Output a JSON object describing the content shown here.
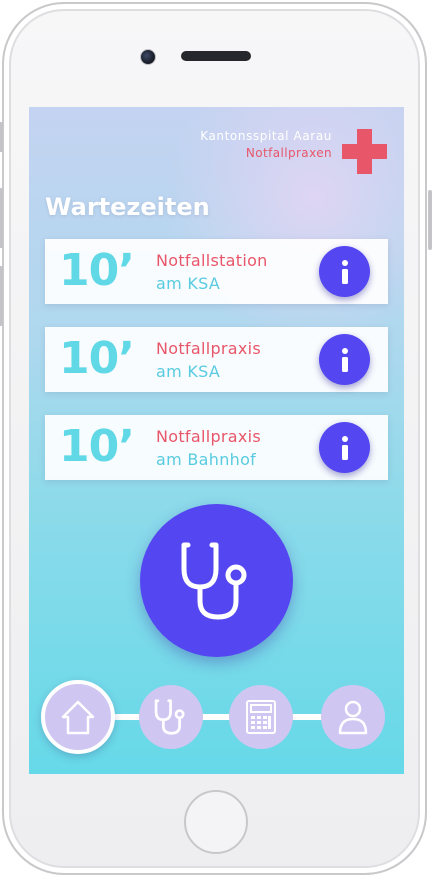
{
  "header": {
    "hospital_name": "Kantonsspital Aarau",
    "service_name": "Notfallpraxen",
    "logo_icon": "red-cross-icon"
  },
  "section_title": "Wartezeiten",
  "wait_cards": [
    {
      "wait": "10’",
      "line1": "Notfallstation",
      "line2": "am KSA",
      "icon": "info-icon"
    },
    {
      "wait": "10’",
      "line1": "Notfallpraxis",
      "line2": "am KSA",
      "icon": "info-icon"
    },
    {
      "wait": "10’",
      "line1": "Notfallpraxis",
      "line2": "am Bahnhof",
      "icon": "info-icon"
    }
  ],
  "main_action": {
    "icon": "stethoscope-icon"
  },
  "bottom_nav": [
    {
      "id": "home",
      "icon": "home-icon",
      "active": true
    },
    {
      "id": "doctor",
      "icon": "stethoscope-icon",
      "active": false
    },
    {
      "id": "calculator",
      "icon": "calculator-icon",
      "active": false
    },
    {
      "id": "profile",
      "icon": "user-icon",
      "active": false
    }
  ],
  "colors": {
    "accent": "#5447f2",
    "red": "#e8566a",
    "cyan": "#60d8e6",
    "nav_bubble": "#cfc6f2"
  }
}
